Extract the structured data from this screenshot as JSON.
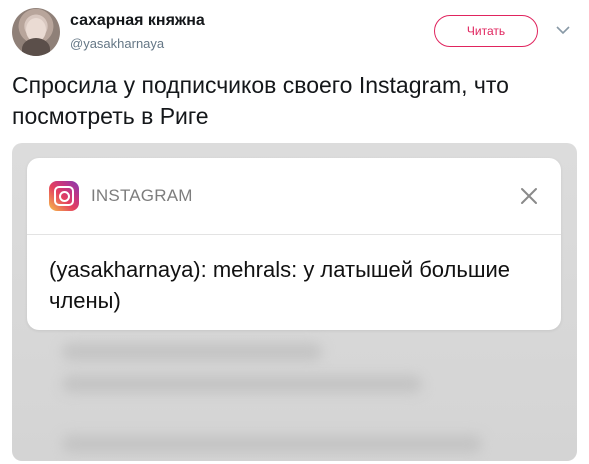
{
  "header": {
    "display_name": "сахарная княжна",
    "handle": "@yasakharnaya",
    "follow_label": "Читать"
  },
  "tweet": {
    "text": "Спросила у подписчиков своего Instagram, что посмотреть в Риге"
  },
  "notification": {
    "app_name": "INSTAGRAM",
    "message": "(yasakharnaya): mehrals: у латышей большие члены)"
  },
  "icons": {
    "avatar": "avatar-image",
    "chevron": "chevron-down-icon",
    "app": "instagram-icon",
    "close": "close-icon"
  },
  "colors": {
    "follow_accent": "#e0245e",
    "text_primary": "#14171a",
    "text_secondary": "#657786"
  }
}
